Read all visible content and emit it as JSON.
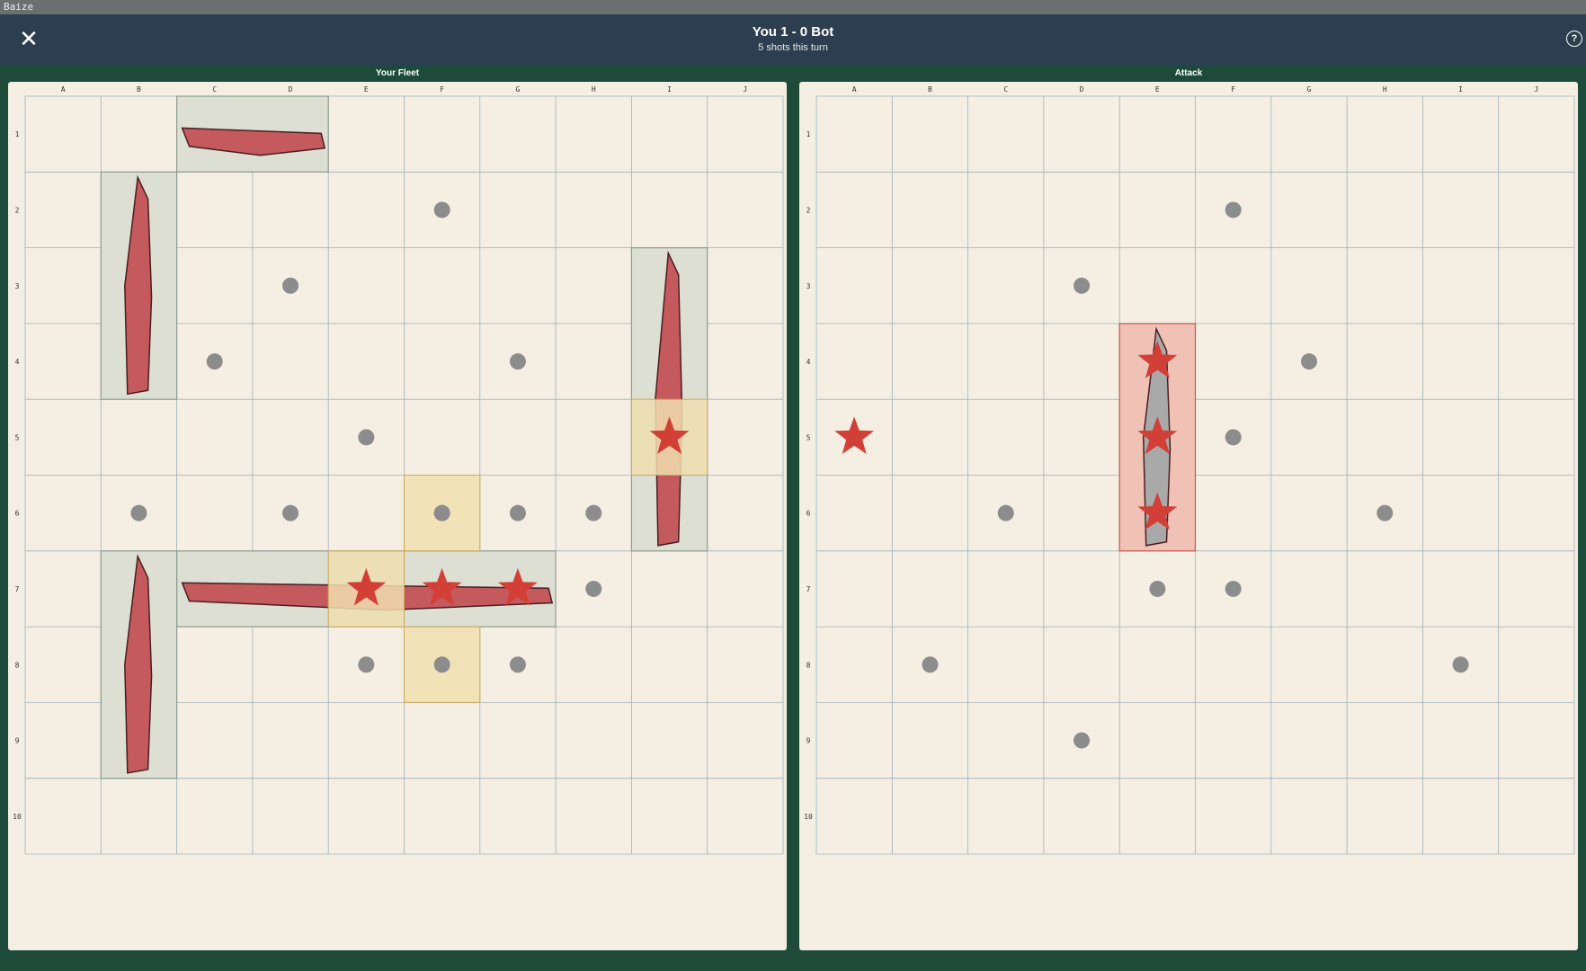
{
  "app": {
    "window_title": "Baize"
  },
  "header": {
    "score": "You 1 - 0 Bot",
    "shots": "5 shots this turn",
    "close_icon": "close-icon",
    "help_icon": "help-circle-icon",
    "help_glyph": "?"
  },
  "colors": {
    "grid_bg": "#f5efe3",
    "grid_line": "#9fb0b8",
    "ship_cell": "#dcdfd2",
    "miss_peg": "#8c8c8c",
    "hit_star": "#d23f36",
    "sunk_cell": "#f0c1b5",
    "shot_cell": "#f0dfb0",
    "ship_hull": "#c55a5e"
  },
  "columns": [
    "A",
    "B",
    "C",
    "D",
    "E",
    "F",
    "G",
    "H",
    "I",
    "J"
  ],
  "rows": [
    "1",
    "2",
    "3",
    "4",
    "5",
    "6",
    "7",
    "8",
    "9",
    "10"
  ],
  "fleet": {
    "title": "Your Fleet",
    "ships": [
      {
        "name": "destroyer",
        "col": 2,
        "row": 0,
        "len": 2,
        "dir": "h"
      },
      {
        "name": "carrier-vertical",
        "col": 1,
        "row": 1,
        "len": 3,
        "dir": "v"
      },
      {
        "name": "battleship",
        "col": 8,
        "row": 2,
        "len": 4,
        "dir": "v"
      },
      {
        "name": "carrier",
        "col": 2,
        "row": 6,
        "len": 5,
        "dir": "h"
      },
      {
        "name": "cruiser",
        "col": 1,
        "row": 6,
        "len": 3,
        "dir": "v"
      }
    ],
    "highlight_cells": [
      [
        8,
        4
      ],
      [
        5,
        5
      ],
      [
        4,
        6
      ],
      [
        5,
        7
      ]
    ],
    "hits": [
      [
        8,
        4
      ],
      [
        4,
        6
      ],
      [
        5,
        6
      ],
      [
        6,
        6
      ]
    ],
    "misses": [
      [
        5,
        1
      ],
      [
        3,
        2
      ],
      [
        2,
        3
      ],
      [
        6,
        3
      ],
      [
        4,
        4
      ],
      [
        1,
        5
      ],
      [
        5,
        5
      ],
      [
        3,
        5
      ],
      [
        5,
        5
      ],
      [
        6,
        5
      ],
      [
        7,
        5
      ],
      [
        7,
        6
      ],
      [
        4,
        7
      ],
      [
        5,
        7
      ],
      [
        6,
        7
      ]
    ]
  },
  "attack": {
    "title": "Attack",
    "sunk_ship": {
      "name": "sunk-cruiser",
      "col": 4,
      "row": 3,
      "len": 3,
      "dir": "v"
    },
    "hits": [
      [
        0,
        4
      ],
      [
        4,
        3
      ],
      [
        4,
        4
      ],
      [
        4,
        5
      ]
    ],
    "misses": [
      [
        5,
        1
      ],
      [
        3,
        2
      ],
      [
        6,
        3
      ],
      [
        5,
        4
      ],
      [
        2,
        5
      ],
      [
        7,
        5
      ],
      [
        4,
        6
      ],
      [
        5,
        6
      ],
      [
        1,
        7
      ],
      [
        8,
        7
      ],
      [
        3,
        8
      ]
    ]
  }
}
